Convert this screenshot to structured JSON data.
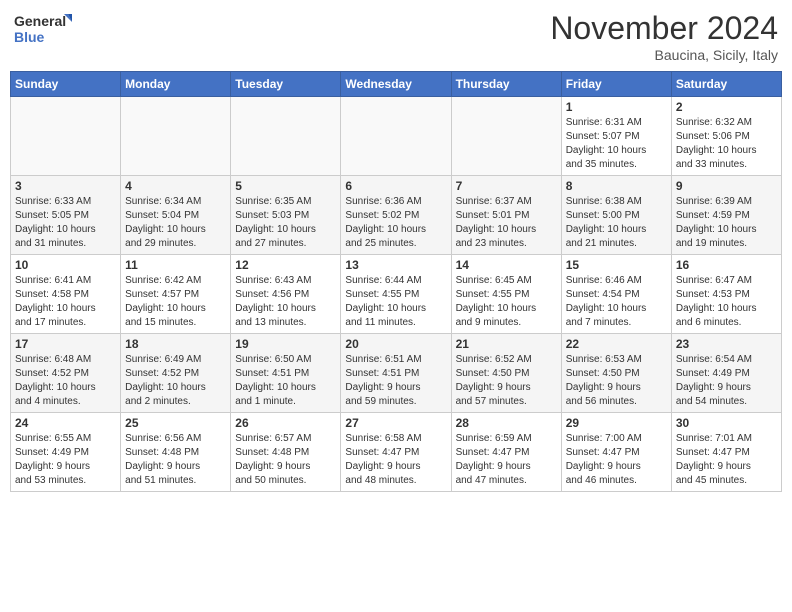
{
  "header": {
    "logo_general": "General",
    "logo_blue": "Blue",
    "month_title": "November 2024",
    "location": "Baucina, Sicily, Italy"
  },
  "days_of_week": [
    "Sunday",
    "Monday",
    "Tuesday",
    "Wednesday",
    "Thursday",
    "Friday",
    "Saturday"
  ],
  "weeks": [
    [
      {
        "day": "",
        "info": ""
      },
      {
        "day": "",
        "info": ""
      },
      {
        "day": "",
        "info": ""
      },
      {
        "day": "",
        "info": ""
      },
      {
        "day": "",
        "info": ""
      },
      {
        "day": "1",
        "info": "Sunrise: 6:31 AM\nSunset: 5:07 PM\nDaylight: 10 hours\nand 35 minutes."
      },
      {
        "day": "2",
        "info": "Sunrise: 6:32 AM\nSunset: 5:06 PM\nDaylight: 10 hours\nand 33 minutes."
      }
    ],
    [
      {
        "day": "3",
        "info": "Sunrise: 6:33 AM\nSunset: 5:05 PM\nDaylight: 10 hours\nand 31 minutes."
      },
      {
        "day": "4",
        "info": "Sunrise: 6:34 AM\nSunset: 5:04 PM\nDaylight: 10 hours\nand 29 minutes."
      },
      {
        "day": "5",
        "info": "Sunrise: 6:35 AM\nSunset: 5:03 PM\nDaylight: 10 hours\nand 27 minutes."
      },
      {
        "day": "6",
        "info": "Sunrise: 6:36 AM\nSunset: 5:02 PM\nDaylight: 10 hours\nand 25 minutes."
      },
      {
        "day": "7",
        "info": "Sunrise: 6:37 AM\nSunset: 5:01 PM\nDaylight: 10 hours\nand 23 minutes."
      },
      {
        "day": "8",
        "info": "Sunrise: 6:38 AM\nSunset: 5:00 PM\nDaylight: 10 hours\nand 21 minutes."
      },
      {
        "day": "9",
        "info": "Sunrise: 6:39 AM\nSunset: 4:59 PM\nDaylight: 10 hours\nand 19 minutes."
      }
    ],
    [
      {
        "day": "10",
        "info": "Sunrise: 6:41 AM\nSunset: 4:58 PM\nDaylight: 10 hours\nand 17 minutes."
      },
      {
        "day": "11",
        "info": "Sunrise: 6:42 AM\nSunset: 4:57 PM\nDaylight: 10 hours\nand 15 minutes."
      },
      {
        "day": "12",
        "info": "Sunrise: 6:43 AM\nSunset: 4:56 PM\nDaylight: 10 hours\nand 13 minutes."
      },
      {
        "day": "13",
        "info": "Sunrise: 6:44 AM\nSunset: 4:55 PM\nDaylight: 10 hours\nand 11 minutes."
      },
      {
        "day": "14",
        "info": "Sunrise: 6:45 AM\nSunset: 4:55 PM\nDaylight: 10 hours\nand 9 minutes."
      },
      {
        "day": "15",
        "info": "Sunrise: 6:46 AM\nSunset: 4:54 PM\nDaylight: 10 hours\nand 7 minutes."
      },
      {
        "day": "16",
        "info": "Sunrise: 6:47 AM\nSunset: 4:53 PM\nDaylight: 10 hours\nand 6 minutes."
      }
    ],
    [
      {
        "day": "17",
        "info": "Sunrise: 6:48 AM\nSunset: 4:52 PM\nDaylight: 10 hours\nand 4 minutes."
      },
      {
        "day": "18",
        "info": "Sunrise: 6:49 AM\nSunset: 4:52 PM\nDaylight: 10 hours\nand 2 minutes."
      },
      {
        "day": "19",
        "info": "Sunrise: 6:50 AM\nSunset: 4:51 PM\nDaylight: 10 hours\nand 1 minute."
      },
      {
        "day": "20",
        "info": "Sunrise: 6:51 AM\nSunset: 4:51 PM\nDaylight: 9 hours\nand 59 minutes."
      },
      {
        "day": "21",
        "info": "Sunrise: 6:52 AM\nSunset: 4:50 PM\nDaylight: 9 hours\nand 57 minutes."
      },
      {
        "day": "22",
        "info": "Sunrise: 6:53 AM\nSunset: 4:50 PM\nDaylight: 9 hours\nand 56 minutes."
      },
      {
        "day": "23",
        "info": "Sunrise: 6:54 AM\nSunset: 4:49 PM\nDaylight: 9 hours\nand 54 minutes."
      }
    ],
    [
      {
        "day": "24",
        "info": "Sunrise: 6:55 AM\nSunset: 4:49 PM\nDaylight: 9 hours\nand 53 minutes."
      },
      {
        "day": "25",
        "info": "Sunrise: 6:56 AM\nSunset: 4:48 PM\nDaylight: 9 hours\nand 51 minutes."
      },
      {
        "day": "26",
        "info": "Sunrise: 6:57 AM\nSunset: 4:48 PM\nDaylight: 9 hours\nand 50 minutes."
      },
      {
        "day": "27",
        "info": "Sunrise: 6:58 AM\nSunset: 4:47 PM\nDaylight: 9 hours\nand 48 minutes."
      },
      {
        "day": "28",
        "info": "Sunrise: 6:59 AM\nSunset: 4:47 PM\nDaylight: 9 hours\nand 47 minutes."
      },
      {
        "day": "29",
        "info": "Sunrise: 7:00 AM\nSunset: 4:47 PM\nDaylight: 9 hours\nand 46 minutes."
      },
      {
        "day": "30",
        "info": "Sunrise: 7:01 AM\nSunset: 4:47 PM\nDaylight: 9 hours\nand 45 minutes."
      }
    ]
  ]
}
